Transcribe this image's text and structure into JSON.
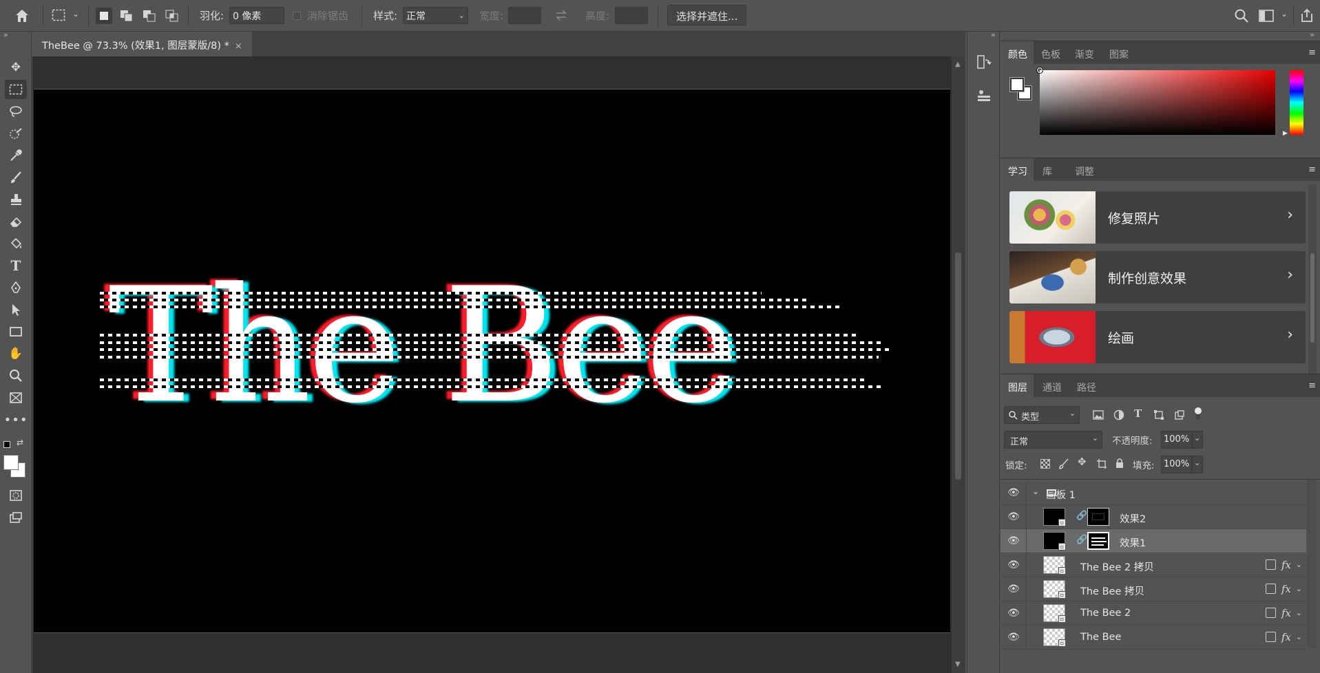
{
  "options_bar": {
    "feather_label": "羽化:",
    "feather_value": "0 像素",
    "antialias_label": "消除锯齿",
    "style_label": "样式:",
    "style_value": "正常",
    "width_label": "宽度:",
    "height_label": "高度:",
    "select_mask_button": "选择并遮住..."
  },
  "document": {
    "tab_title": "TheBee @ 73.3% (效果1, 图层蒙版/8) *",
    "close_glyph": "×",
    "canvas_text": "The Bee"
  },
  "color_panel": {
    "tabs": [
      "颜色",
      "色板",
      "渐变",
      "图案"
    ],
    "active_tab": "颜色",
    "foreground": "#ffffff",
    "background": "#ffffff",
    "hue_color": "#e80000"
  },
  "learn_panel": {
    "tabs": [
      "学习",
      "库",
      "调整"
    ],
    "active_tab": "学习",
    "cards": [
      {
        "title": "修复照片"
      },
      {
        "title": "制作创意效果"
      },
      {
        "title": "绘画"
      }
    ]
  },
  "layers_panel": {
    "tabs": [
      "图层",
      "通道",
      "路径"
    ],
    "active_tab": "图层",
    "filter_label": "类型",
    "blend_mode": "正常",
    "opacity_label": "不透明度:",
    "opacity_value": "100%",
    "lock_label": "锁定:",
    "fill_label": "填充:",
    "fill_value": "100%",
    "group_name": "画板 1",
    "layers": [
      {
        "name": "效果2",
        "selected": false,
        "has_mask": true,
        "fx": false
      },
      {
        "name": "效果1",
        "selected": true,
        "has_mask": true,
        "fx": false
      },
      {
        "name": "The Bee 2 拷贝",
        "selected": false,
        "has_mask": false,
        "fx": true
      },
      {
        "name": "The Bee 拷贝",
        "selected": false,
        "has_mask": false,
        "fx": true
      },
      {
        "name": "The Bee 2",
        "selected": false,
        "has_mask": false,
        "fx": true
      },
      {
        "name": "The Bee",
        "selected": false,
        "has_mask": false,
        "fx": true
      }
    ]
  },
  "icons": {
    "home": "⌂",
    "search": "⌕",
    "share": "⇪",
    "eye": "👁",
    "fx": "fx",
    "menu": "≡",
    "chevron_right": "›",
    "chevron_down": "⌄",
    "link": "8"
  }
}
